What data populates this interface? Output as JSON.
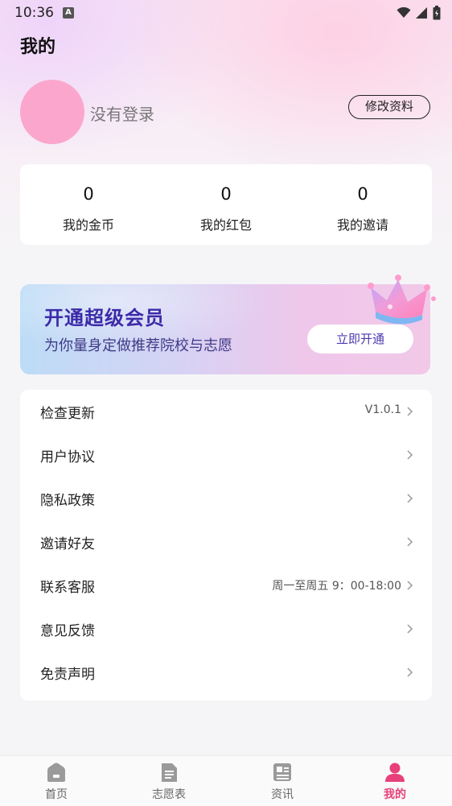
{
  "status_bar": {
    "time": "10:36",
    "badge": "A"
  },
  "header": {
    "title": "我的"
  },
  "profile": {
    "login_text": "没有登录",
    "edit_button": "修改资料"
  },
  "stats": [
    {
      "value": "0",
      "label": "我的金币"
    },
    {
      "value": "0",
      "label": "我的红包"
    },
    {
      "value": "0",
      "label": "我的邀请"
    }
  ],
  "vip": {
    "title": "开通超级会员",
    "subtitle": "为你量身定做推荐院校与志愿",
    "button": "立即开通"
  },
  "menu": [
    {
      "label": "检查更新",
      "value": "V1.0.1"
    },
    {
      "label": "用户协议",
      "value": ""
    },
    {
      "label": "隐私政策",
      "value": ""
    },
    {
      "label": "邀请好友",
      "value": ""
    },
    {
      "label": "联系客服",
      "value": "周一至周五 9：00-18:00"
    },
    {
      "label": "意见反馈",
      "value": ""
    },
    {
      "label": "免责声明",
      "value": ""
    }
  ],
  "tabs": [
    {
      "label": "首页",
      "icon": "home-icon"
    },
    {
      "label": "志愿表",
      "icon": "document-icon"
    },
    {
      "label": "资讯",
      "icon": "news-icon"
    },
    {
      "label": "我的",
      "icon": "user-icon",
      "active": true
    }
  ],
  "colors": {
    "accent": "#e8407a",
    "vip_title": "#3d2aa8",
    "avatar": "#fba7cd"
  }
}
